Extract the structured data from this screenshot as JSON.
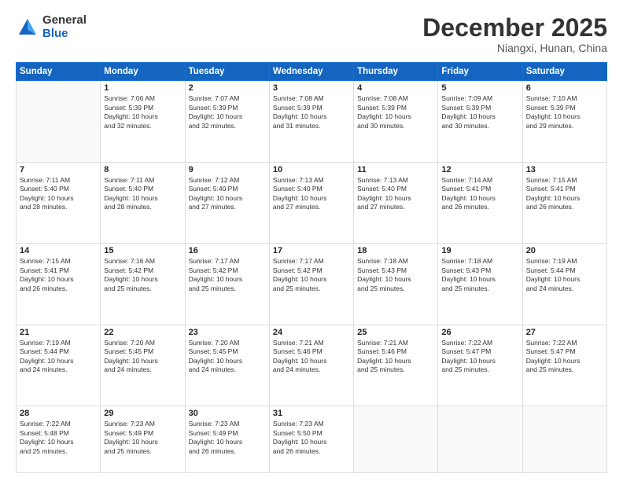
{
  "logo": {
    "general": "General",
    "blue": "Blue"
  },
  "header": {
    "title": "December 2025",
    "subtitle": "Niangxi, Hunan, China"
  },
  "days_of_week": [
    "Sunday",
    "Monday",
    "Tuesday",
    "Wednesday",
    "Thursday",
    "Friday",
    "Saturday"
  ],
  "weeks": [
    [
      {
        "day": "",
        "info": ""
      },
      {
        "day": "1",
        "info": "Sunrise: 7:06 AM\nSunset: 5:39 PM\nDaylight: 10 hours\nand 32 minutes."
      },
      {
        "day": "2",
        "info": "Sunrise: 7:07 AM\nSunset: 5:39 PM\nDaylight: 10 hours\nand 32 minutes."
      },
      {
        "day": "3",
        "info": "Sunrise: 7:08 AM\nSunset: 5:39 PM\nDaylight: 10 hours\nand 31 minutes."
      },
      {
        "day": "4",
        "info": "Sunrise: 7:08 AM\nSunset: 5:39 PM\nDaylight: 10 hours\nand 30 minutes."
      },
      {
        "day": "5",
        "info": "Sunrise: 7:09 AM\nSunset: 5:39 PM\nDaylight: 10 hours\nand 30 minutes."
      },
      {
        "day": "6",
        "info": "Sunrise: 7:10 AM\nSunset: 5:39 PM\nDaylight: 10 hours\nand 29 minutes."
      }
    ],
    [
      {
        "day": "7",
        "info": "Sunrise: 7:11 AM\nSunset: 5:40 PM\nDaylight: 10 hours\nand 28 minutes."
      },
      {
        "day": "8",
        "info": "Sunrise: 7:11 AM\nSunset: 5:40 PM\nDaylight: 10 hours\nand 28 minutes."
      },
      {
        "day": "9",
        "info": "Sunrise: 7:12 AM\nSunset: 5:40 PM\nDaylight: 10 hours\nand 27 minutes."
      },
      {
        "day": "10",
        "info": "Sunrise: 7:13 AM\nSunset: 5:40 PM\nDaylight: 10 hours\nand 27 minutes."
      },
      {
        "day": "11",
        "info": "Sunrise: 7:13 AM\nSunset: 5:40 PM\nDaylight: 10 hours\nand 27 minutes."
      },
      {
        "day": "12",
        "info": "Sunrise: 7:14 AM\nSunset: 5:41 PM\nDaylight: 10 hours\nand 26 minutes."
      },
      {
        "day": "13",
        "info": "Sunrise: 7:15 AM\nSunset: 5:41 PM\nDaylight: 10 hours\nand 26 minutes."
      }
    ],
    [
      {
        "day": "14",
        "info": "Sunrise: 7:15 AM\nSunset: 5:41 PM\nDaylight: 10 hours\nand 26 minutes."
      },
      {
        "day": "15",
        "info": "Sunrise: 7:16 AM\nSunset: 5:42 PM\nDaylight: 10 hours\nand 25 minutes."
      },
      {
        "day": "16",
        "info": "Sunrise: 7:17 AM\nSunset: 5:42 PM\nDaylight: 10 hours\nand 25 minutes."
      },
      {
        "day": "17",
        "info": "Sunrise: 7:17 AM\nSunset: 5:42 PM\nDaylight: 10 hours\nand 25 minutes."
      },
      {
        "day": "18",
        "info": "Sunrise: 7:18 AM\nSunset: 5:43 PM\nDaylight: 10 hours\nand 25 minutes."
      },
      {
        "day": "19",
        "info": "Sunrise: 7:18 AM\nSunset: 5:43 PM\nDaylight: 10 hours\nand 25 minutes."
      },
      {
        "day": "20",
        "info": "Sunrise: 7:19 AM\nSunset: 5:44 PM\nDaylight: 10 hours\nand 24 minutes."
      }
    ],
    [
      {
        "day": "21",
        "info": "Sunrise: 7:19 AM\nSunset: 5:44 PM\nDaylight: 10 hours\nand 24 minutes."
      },
      {
        "day": "22",
        "info": "Sunrise: 7:20 AM\nSunset: 5:45 PM\nDaylight: 10 hours\nand 24 minutes."
      },
      {
        "day": "23",
        "info": "Sunrise: 7:20 AM\nSunset: 5:45 PM\nDaylight: 10 hours\nand 24 minutes."
      },
      {
        "day": "24",
        "info": "Sunrise: 7:21 AM\nSunset: 5:46 PM\nDaylight: 10 hours\nand 24 minutes."
      },
      {
        "day": "25",
        "info": "Sunrise: 7:21 AM\nSunset: 5:46 PM\nDaylight: 10 hours\nand 25 minutes."
      },
      {
        "day": "26",
        "info": "Sunrise: 7:22 AM\nSunset: 5:47 PM\nDaylight: 10 hours\nand 25 minutes."
      },
      {
        "day": "27",
        "info": "Sunrise: 7:22 AM\nSunset: 5:47 PM\nDaylight: 10 hours\nand 25 minutes."
      }
    ],
    [
      {
        "day": "28",
        "info": "Sunrise: 7:22 AM\nSunset: 5:48 PM\nDaylight: 10 hours\nand 25 minutes."
      },
      {
        "day": "29",
        "info": "Sunrise: 7:23 AM\nSunset: 5:49 PM\nDaylight: 10 hours\nand 25 minutes."
      },
      {
        "day": "30",
        "info": "Sunrise: 7:23 AM\nSunset: 5:49 PM\nDaylight: 10 hours\nand 26 minutes."
      },
      {
        "day": "31",
        "info": "Sunrise: 7:23 AM\nSunset: 5:50 PM\nDaylight: 10 hours\nand 26 minutes."
      },
      {
        "day": "",
        "info": ""
      },
      {
        "day": "",
        "info": ""
      },
      {
        "day": "",
        "info": ""
      }
    ]
  ]
}
